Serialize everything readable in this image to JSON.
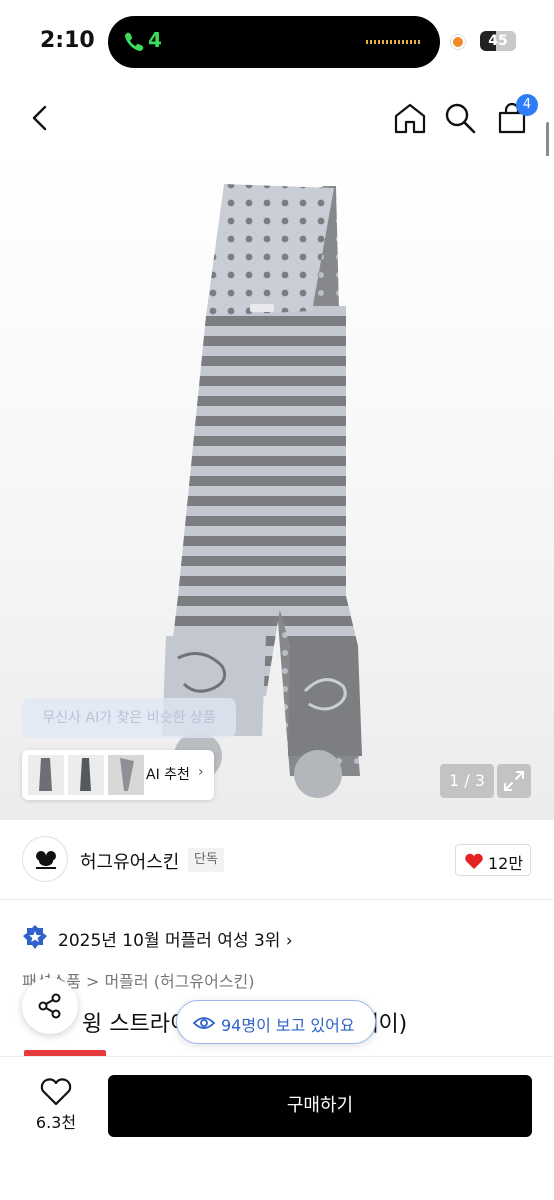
{
  "status_bar": {
    "time": "2:10",
    "call_indicator": "4",
    "battery": "45",
    "battery_level": 0.45,
    "call_color": "#3ddc5a"
  },
  "nav": {
    "back_icon": "chevron-left-icon",
    "home_icon": "home-icon",
    "search_icon": "search-icon",
    "cart_icon": "shopping-bag-icon",
    "cart_count": "4"
  },
  "gallery": {
    "ai_tooltip": "무신사 AI가 찾은 비슷한 상품",
    "ai_recommend_label": "AI 추천",
    "ai_recommend_chevron": "›",
    "page_indicator": "1 / 3",
    "expand_icon": "expand-icon"
  },
  "brand": {
    "name": "허그유어스킨",
    "badge": "단독",
    "like_count": "12만",
    "like_color": "#e52222"
  },
  "ranking": {
    "text": "2025년 10월 머플러 여성 3위",
    "chevron": "›"
  },
  "breadcrumb": {
    "path": "패션소품 > 머플러 (허그유어스킨)"
  },
  "product": {
    "title_visible": "윙 스트라이",
    "title_end": "베이)"
  },
  "viewers": {
    "text": "94명이 보고 있어요"
  },
  "bottom_bar": {
    "wish_count": "6.3천",
    "buy_label": "구매하기"
  }
}
